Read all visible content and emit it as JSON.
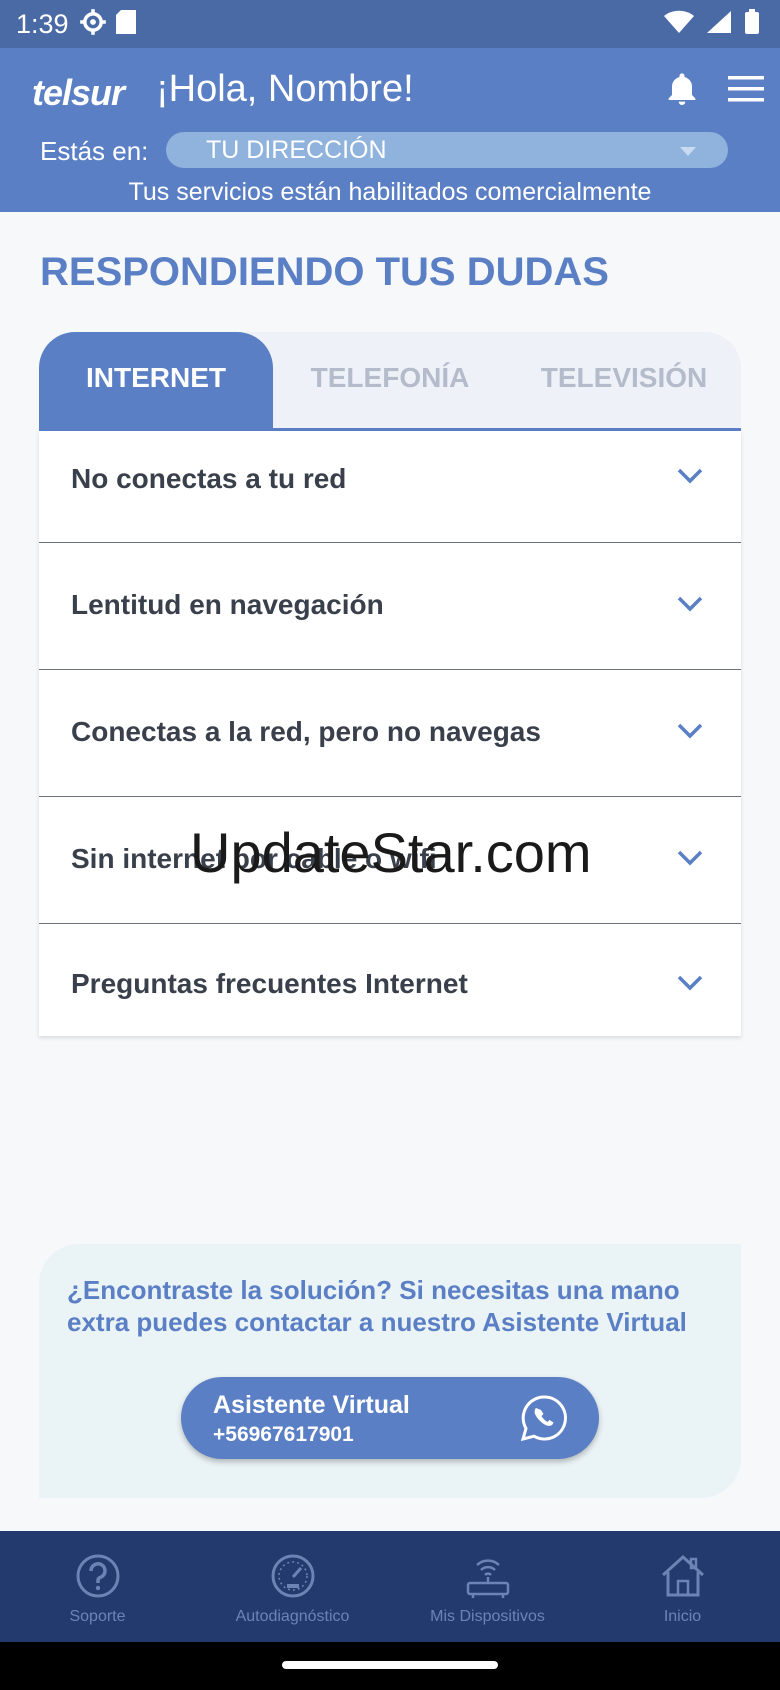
{
  "status_bar": {
    "time": "1:39"
  },
  "header": {
    "logo": "telsur",
    "greeting": "¡Hola, Nombre!",
    "location_label": "Estás en:",
    "location_value": "TU DIRECCIÓN",
    "services_status": "Tus servicios están habilitados comercialmente"
  },
  "main": {
    "title": "RESPONDIENDO TUS DUDAS",
    "tabs": [
      {
        "label": "INTERNET",
        "active": true
      },
      {
        "label": "TELEFONÍA",
        "active": false
      },
      {
        "label": "TELEVISIÓN",
        "active": false
      }
    ],
    "faq_items": [
      {
        "label": "No conectas a tu red"
      },
      {
        "label": "Lentitud en navegación"
      },
      {
        "label": "Conectas a la red, pero no navegas"
      },
      {
        "label": "Sin internet por cable o wifi"
      },
      {
        "label": "Preguntas frecuentes Internet"
      }
    ],
    "watermark": "UpdateStar.com"
  },
  "help": {
    "text": "¿Encontraste la solución? Si necesitas una mano extra puedes contactar a nuestro Asistente Virtual",
    "button_name": "Asistente Virtual",
    "button_phone": "+56967617901"
  },
  "bottom_nav": [
    {
      "label": "Soporte",
      "icon": "question-icon"
    },
    {
      "label": "Autodiagnóstico",
      "icon": "speedometer-icon"
    },
    {
      "label": "Mis Dispositivos",
      "icon": "router-icon"
    },
    {
      "label": "Inicio",
      "icon": "home-icon"
    }
  ],
  "colors": {
    "brand": "#5a7fc4",
    "status_bar": "#4a6aa6",
    "nav_bg": "#223a6e",
    "nav_fg": "#6b84b5",
    "help_bg": "#eaf3f6"
  }
}
